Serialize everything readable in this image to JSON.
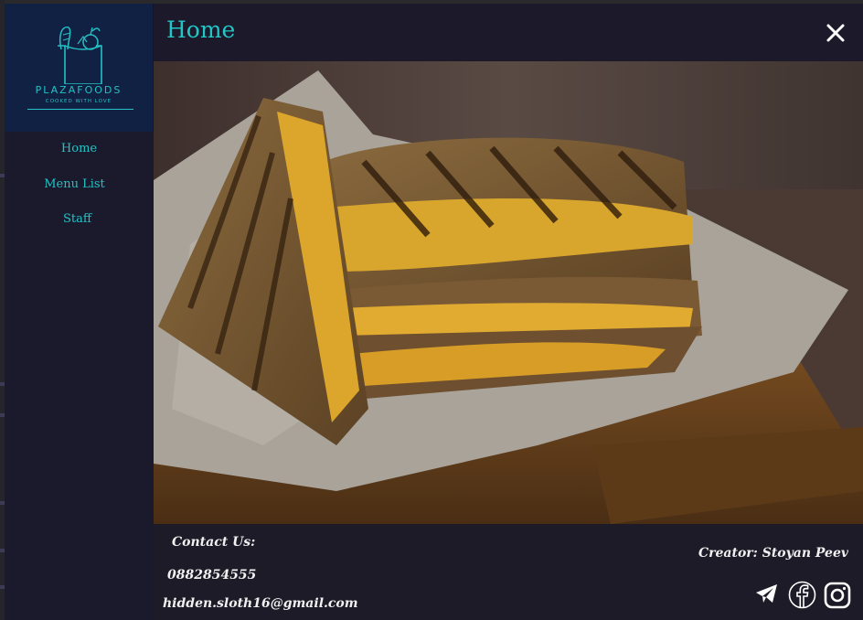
{
  "brand": {
    "name": "PLAZAFOODS",
    "tagline": "COOKED WITH LOVE",
    "accent_color": "#22c3c5"
  },
  "sidebar": {
    "items": [
      {
        "label": "Home"
      },
      {
        "label": "Menu List"
      },
      {
        "label": "Staff"
      }
    ]
  },
  "header": {
    "title": "Home",
    "close_icon": "close-icon"
  },
  "hero": {
    "subject": "grilled cheese sandwich on wooden board"
  },
  "footer": {
    "contact_heading": "Contact Us:",
    "phone": "0882854555",
    "email": "hidden.sloth16@gmail.com",
    "creator": "Creator: Stoyan Peev",
    "social_icons": [
      "telegram-icon",
      "facebook-icon",
      "instagram-icon"
    ]
  }
}
